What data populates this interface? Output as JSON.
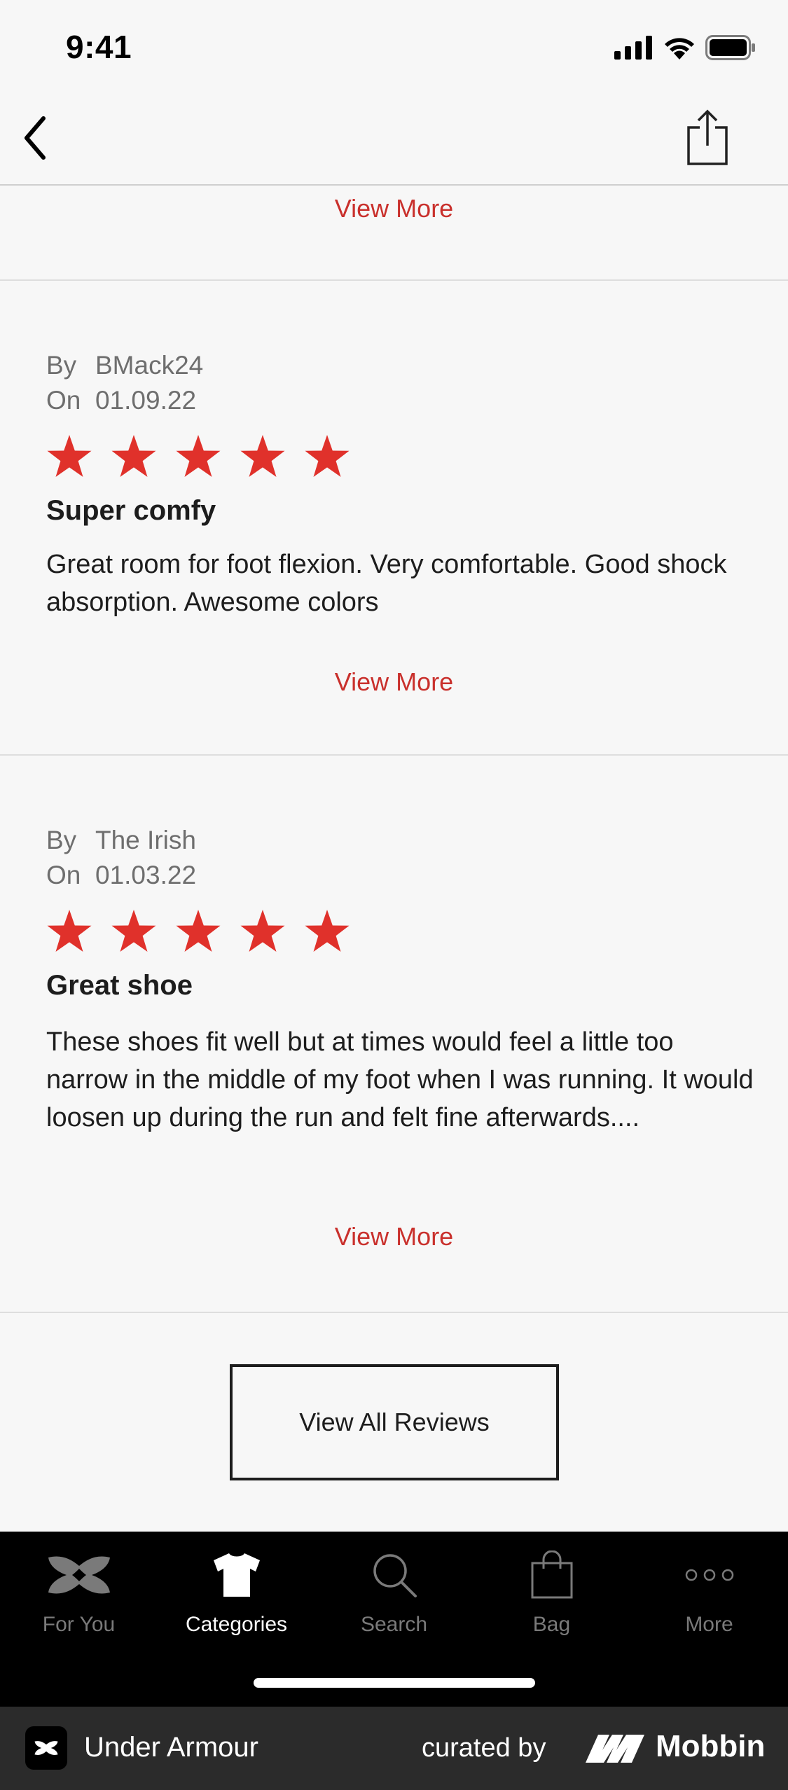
{
  "status_bar": {
    "time": "9:41"
  },
  "top": {
    "view_more": "View More"
  },
  "reviews": [
    {
      "by_label": "By",
      "author": "BMack24",
      "on_label": "On",
      "date": "01.09.22",
      "rating": 5,
      "title": "Super comfy",
      "body": "Great room for foot flexion. Very comfortable. Good shock absorption. Awesome colors",
      "view_more": "View More"
    },
    {
      "by_label": "By",
      "author": "The Irish",
      "on_label": "On",
      "date": "01.03.22",
      "rating": 5,
      "title": "Great shoe",
      "body": "These shoes fit well but at times would feel a little too narrow in the middle of my foot when I was running. It would loosen up during the run and felt fine afterwards....",
      "view_more": "View More"
    }
  ],
  "view_all_reviews": "View All Reviews",
  "tab_bar": {
    "items": [
      {
        "label": "For You",
        "icon": "under-armour-icon"
      },
      {
        "label": "Categories",
        "icon": "shirt-icon",
        "active": true
      },
      {
        "label": "Search",
        "icon": "search-icon"
      },
      {
        "label": "Bag",
        "icon": "bag-icon"
      },
      {
        "label": "More",
        "icon": "more-icon"
      }
    ]
  },
  "footer": {
    "app_name": "Under Armour",
    "curated_by": "curated by",
    "brand": "Mobbin"
  },
  "colors": {
    "accent": "#c9302c",
    "star": "#e0312b",
    "tab_bar": "#000000",
    "footer": "#2b2b2b"
  }
}
